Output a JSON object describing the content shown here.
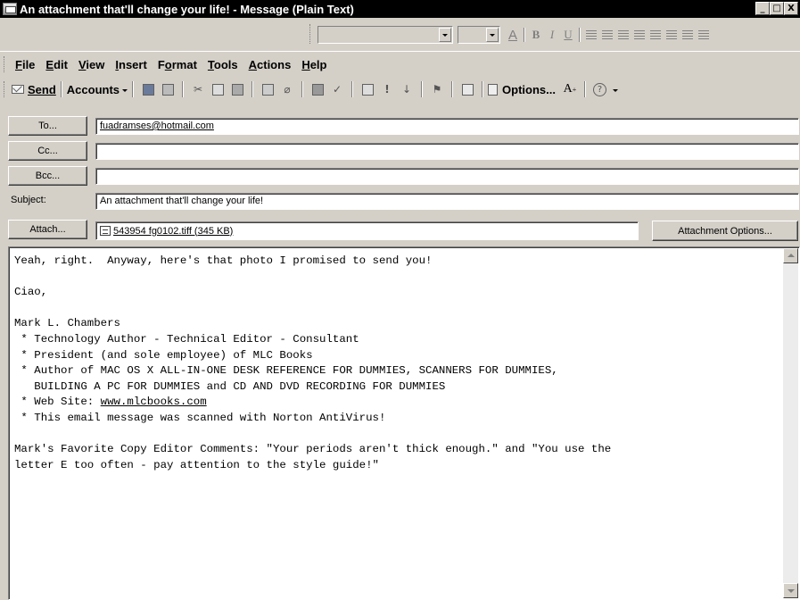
{
  "window": {
    "title": "An attachment that'll change your life! - Message (Plain Text)",
    "buttons": [
      "_",
      "□",
      "X"
    ]
  },
  "format_toolbar": {
    "font_value": "",
    "size_value": "",
    "icons": [
      "font-color-icon",
      "bold-icon",
      "italic-icon",
      "underline-icon",
      "align-left-icon",
      "align-center-icon",
      "align-right-icon",
      "bullets-icon",
      "numbering-icon",
      "decrease-indent-icon",
      "increase-indent-icon",
      "options-icon"
    ],
    "bold": "B",
    "italic": "I",
    "underline": "U"
  },
  "menu": [
    {
      "pre": "",
      "key": "F",
      "post": "ile"
    },
    {
      "pre": "",
      "key": "E",
      "post": "dit"
    },
    {
      "pre": "",
      "key": "V",
      "post": "iew"
    },
    {
      "pre": "",
      "key": "I",
      "post": "nsert"
    },
    {
      "pre": "F",
      "key": "o",
      "post": "rmat"
    },
    {
      "pre": "",
      "key": "T",
      "post": "ools"
    },
    {
      "pre": "",
      "key": "A",
      "post": "ctions"
    },
    {
      "pre": "",
      "key": "H",
      "post": "elp"
    }
  ],
  "toolbar": {
    "send": "Send",
    "accounts": "Accounts",
    "options": "Options...",
    "font_size_icon": "A",
    "icons": [
      "save-icon",
      "print-icon",
      "cut-icon",
      "copy-icon",
      "paste-icon",
      "insert-file-icon",
      "attach-icon",
      "address-book-icon",
      "check-names-icon",
      "signature-icon",
      "high-importance-icon",
      "low-importance-icon",
      "flag-icon",
      "envelope-icon",
      "options-icon",
      "font-size-icon",
      "help-icon"
    ]
  },
  "fields": {
    "to_label": "To...",
    "to_value": "fuadramses@hotmail.com",
    "cc_label": "Cc...",
    "cc_value": "",
    "bcc_label": "Bcc...",
    "bcc_value": "",
    "subject_label": "Subject:",
    "subject_value": "An attachment that'll change your life!",
    "attach_label": "Attach...",
    "attachment_name": "543954 fg0102.tiff (345 KB)",
    "attachment_options": "Attachment Options..."
  },
  "body": {
    "lines": [
      "Yeah, right.  Anyway, here's that photo I promised to send you!",
      "",
      "Ciao,",
      "",
      "Mark L. Chambers",
      " * Technology Author - Technical Editor - Consultant",
      " * President (and sole employee) of MLC Books",
      " * Author of MAC OS X ALL-IN-ONE DESK REFERENCE FOR DUMMIES, SCANNERS FOR DUMMIES,",
      "   BUILDING A PC FOR DUMMIES and CD AND DVD RECORDING FOR DUMMIES",
      " * Web Site: ",
      " * This email message was scanned with Norton AntiVirus!",
      "",
      "Mark's Favorite Copy Editor Comments: \"Your periods aren't thick enough.\" and \"You use the",
      "letter E too often - pay attention to the style guide!\""
    ],
    "website": "www.mlcbooks.com"
  }
}
